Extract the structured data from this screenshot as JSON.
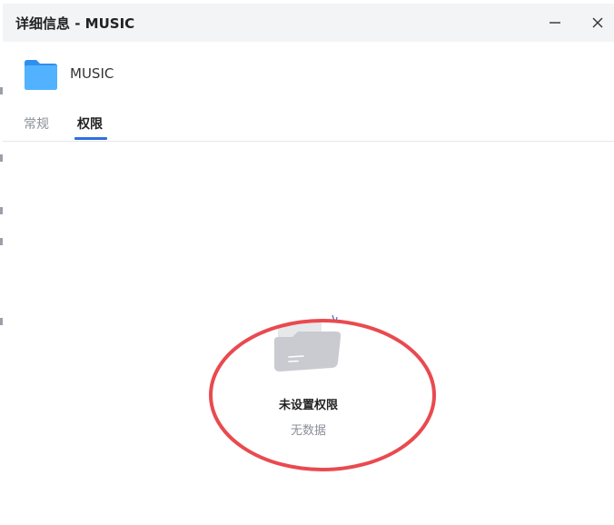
{
  "window": {
    "title": "详细信息 - MUSIC",
    "minimize_icon": "minimize-icon",
    "close_icon": "close-icon"
  },
  "file": {
    "name": "MUSIC",
    "icon": "folder-icon",
    "icon_color": "#3b9df5"
  },
  "tabs": [
    {
      "label": "常规",
      "active": false
    },
    {
      "label": "权限",
      "active": true
    }
  ],
  "empty_state": {
    "icon": "empty-folder-icon",
    "title": "未设置权限",
    "subtitle": "无数据"
  },
  "colors": {
    "accent": "#2f6fe0",
    "annotation": "#e94a4f",
    "titlebar_bg": "#f3f4f6"
  }
}
